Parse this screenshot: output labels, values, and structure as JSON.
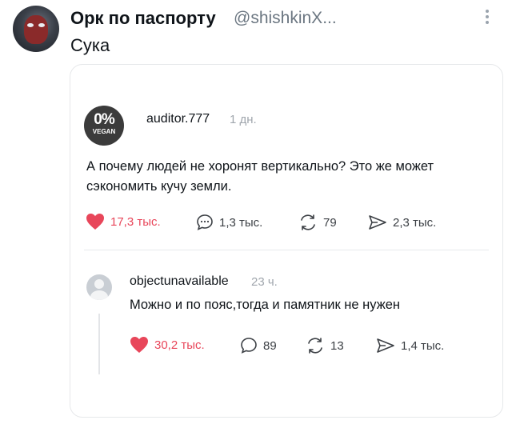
{
  "tweet": {
    "name": "Орк по паспорту",
    "handle": "@shishkinX...",
    "text": "Сука"
  },
  "post": {
    "avatar_big": "0%",
    "avatar_small": "VEGAN",
    "author": "auditor.777",
    "time": "1 дн.",
    "text": "А почему людей не хоронят вертикально? Это же может сэкономить кучу земли.",
    "likes": "17,3 тыс.",
    "comments": "1,3 тыс.",
    "reposts": "79",
    "shares": "2,3 тыс."
  },
  "reply": {
    "author": "objectunavailable",
    "time": "23 ч.",
    "text": "Можно и по пояс,тогда и памятник не нужен",
    "likes": "30,2 тыс.",
    "comments": "89",
    "reposts": "13",
    "shares": "1,4 тыс."
  },
  "colors": {
    "like": "#e8465a",
    "text": "#0f1419",
    "muted": "#6b7681"
  }
}
